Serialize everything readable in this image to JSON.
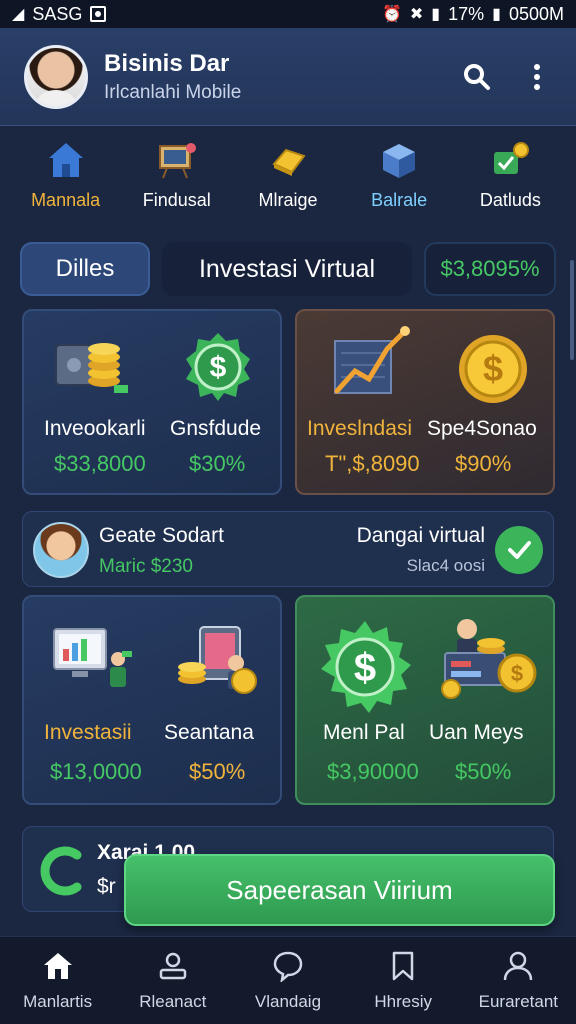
{
  "status_bar": {
    "left_text": "SASG",
    "battery": "17%",
    "time": "0500M"
  },
  "header": {
    "title": "Bisinis Dar",
    "subtitle": "Irlcanlahi Mobile"
  },
  "quick_actions": [
    {
      "label": "Mannala",
      "color": "#f0b43c",
      "icon": "house-icon"
    },
    {
      "label": "Findusal",
      "color": "#ffffff",
      "icon": "presentation-board-icon"
    },
    {
      "label": "Mlraige",
      "color": "#ffffff",
      "icon": "gold-bar-icon"
    },
    {
      "label": "Balrale",
      "color": "#7fd0ff",
      "icon": "cube-icon"
    },
    {
      "label": "Datluds",
      "color": "#ffffff",
      "icon": "check-coin-icon"
    }
  ],
  "tabs": {
    "active": "Dilles",
    "main": "Investasi Virtual",
    "balance": "$3,8095%"
  },
  "cards_top": [
    {
      "label_left": "Inveookarli",
      "label_right": "Gnsfdude",
      "value_left": "$33,8000",
      "value_right": "$30%"
    },
    {
      "label_left": "Inveslndasi",
      "label_right": "Spe4Sonao",
      "value_left": "T\",$,8090",
      "value_right": "$90%"
    }
  ],
  "user_strip": {
    "name": "Geate Sodart",
    "sub": "Maric $230",
    "right_title": "Dangai virtual",
    "right_sub": "Slac4 oosi"
  },
  "cards_bottom": [
    {
      "label_left": "Investasii",
      "label_right": "Seantana",
      "value_left": "$13,0000",
      "value_right": "$50%"
    },
    {
      "label_left": "Menl Pal",
      "label_right": "Uan Meys",
      "value_left": "$3,90000",
      "value_right": "$50%"
    }
  ],
  "promo": {
    "title": "Xarai 1.00",
    "sub": "$r"
  },
  "cta": {
    "label": "Sapeerasan Viirium"
  },
  "bottom_nav": [
    {
      "label": "Manlartis",
      "icon": "home-icon"
    },
    {
      "label": "Rleanact",
      "icon": "user-desk-icon"
    },
    {
      "label": "Vlandaig",
      "icon": "chat-bubble-icon"
    },
    {
      "label": "Hhresiy",
      "icon": "bookmark-icon"
    },
    {
      "label": "Euraretant",
      "icon": "profile-icon"
    }
  ]
}
